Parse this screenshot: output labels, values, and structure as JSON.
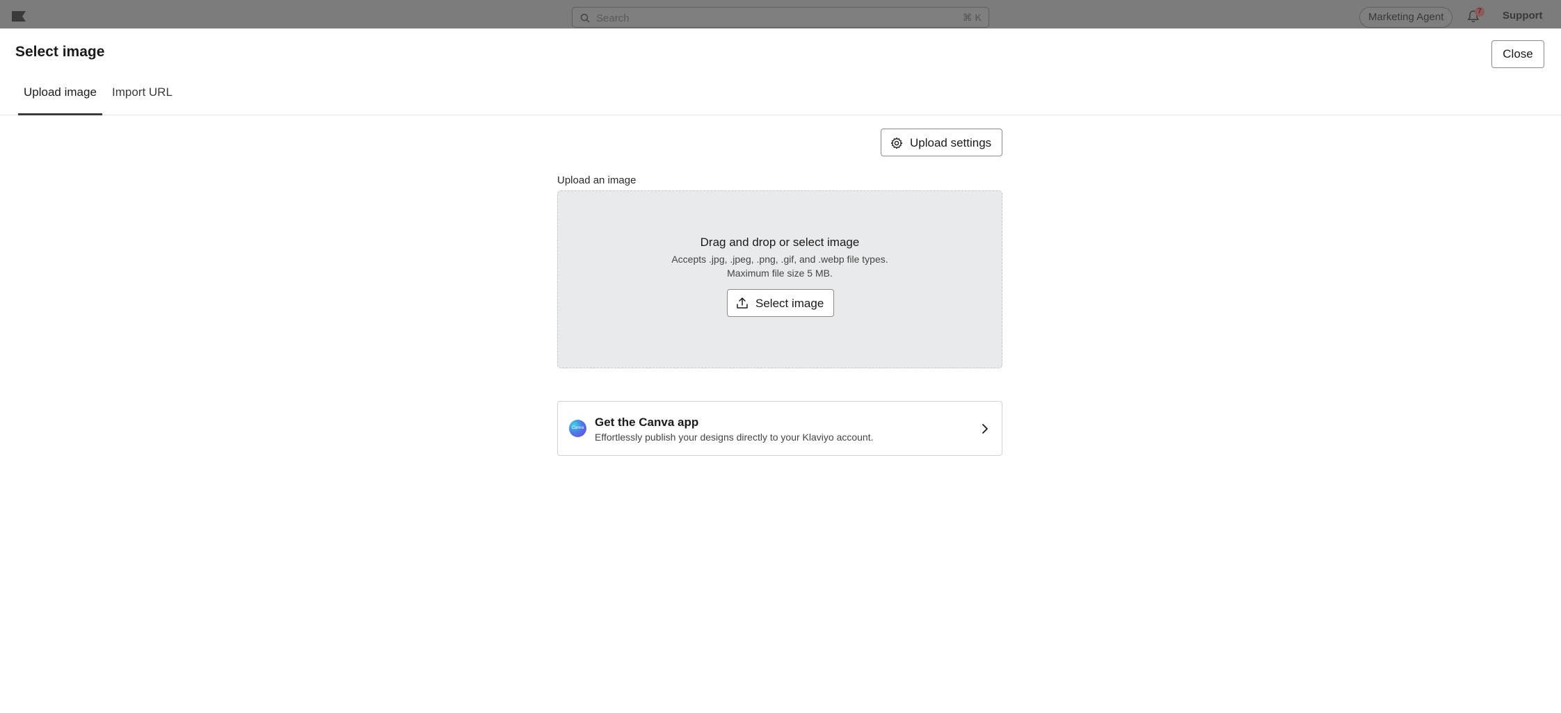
{
  "topbar": {
    "search_placeholder": "Search",
    "search_shortcut": "⌘ K",
    "agent_label": "Marketing Agent",
    "notification_count": "7",
    "support_label": "Support"
  },
  "modal": {
    "title": "Select image",
    "close_label": "Close",
    "tabs": [
      {
        "label": "Upload image",
        "active": true
      },
      {
        "label": "Import URL",
        "active": false
      }
    ]
  },
  "upload": {
    "settings_label": "Upload settings",
    "field_label": "Upload an image",
    "drop_title": "Drag and drop or select image",
    "accepts_text": "Accepts .jpg, .jpeg, .png, .gif, and .webp file types.",
    "max_size_text": "Maximum file size 5 MB.",
    "select_label": "Select image"
  },
  "canva": {
    "logo_text": "Canva",
    "title": "Get the Canva app",
    "description": "Effortlessly publish your designs directly to your Klaviyo account."
  },
  "colors": {
    "overlay": "#7c7c7c",
    "dropzone_bg": "#e9eaec",
    "tab_indicator": "#3a3a3a"
  }
}
